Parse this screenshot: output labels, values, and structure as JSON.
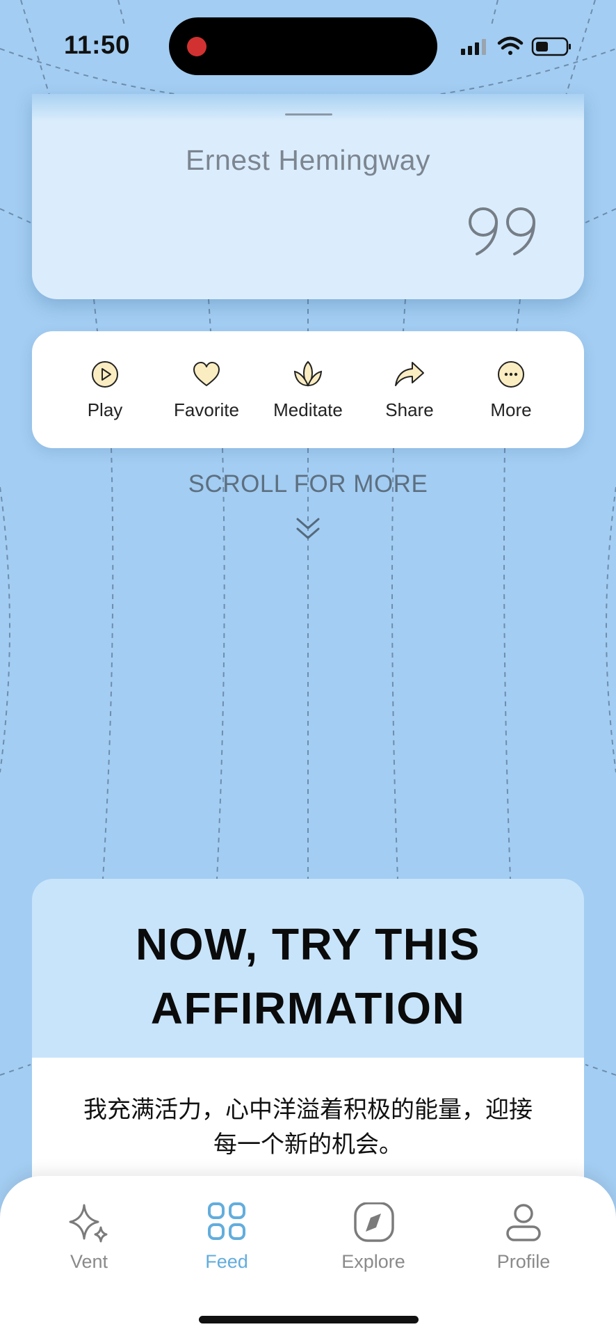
{
  "status_bar": {
    "time": "11:50"
  },
  "quote_card": {
    "author": "Ernest Hemingway"
  },
  "actions": [
    {
      "id": "play",
      "label": "Play",
      "icon": "play-icon"
    },
    {
      "id": "favorite",
      "label": "Favorite",
      "icon": "heart-icon"
    },
    {
      "id": "meditate",
      "label": "Meditate",
      "icon": "lotus-icon"
    },
    {
      "id": "share",
      "label": "Share",
      "icon": "share-arrow-icon"
    },
    {
      "id": "more",
      "label": "More",
      "icon": "more-icon"
    }
  ],
  "scroll_hint": "SCROLL FOR MORE",
  "affirmation": {
    "title_line1": "NOW, TRY THIS",
    "title_line2": "AFFIRMATION",
    "text": "我充满活力，心中洋溢着积极的能量，迎接每一个新的机会。"
  },
  "tabs": [
    {
      "id": "vent",
      "label": "Vent",
      "icon": "sparkle-icon",
      "active": false
    },
    {
      "id": "feed",
      "label": "Feed",
      "icon": "grid-icon",
      "active": true
    },
    {
      "id": "explore",
      "label": "Explore",
      "icon": "compass-icon",
      "active": false
    },
    {
      "id": "profile",
      "label": "Profile",
      "icon": "person-icon",
      "active": false
    }
  ],
  "colors": {
    "background": "#a3cdf2",
    "accent": "#62addd",
    "icon_fill": "#fbedc2",
    "affirmation_header": "#c8e4fb"
  }
}
